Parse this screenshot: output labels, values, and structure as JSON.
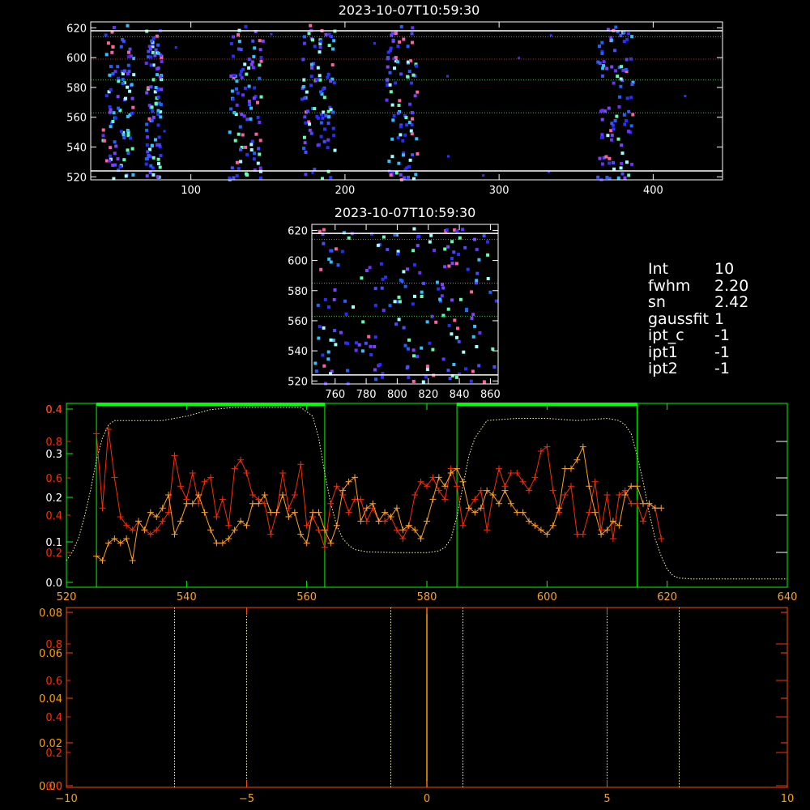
{
  "info_panel": [
    {
      "key": "Int",
      "value": "10"
    },
    {
      "key": "fwhm",
      "value": "2.20"
    },
    {
      "key": "sn",
      "value": "2.42"
    },
    {
      "key": "gaussfit",
      "value": "1"
    },
    {
      "key": "ipt_c",
      "value": "-1"
    },
    {
      "key": "ipt1",
      "value": "-1"
    },
    {
      "key": "ipt2",
      "value": "-1"
    }
  ],
  "colors": {
    "axes": "#ffffff",
    "profile_axes": "#00ff00",
    "red_series": "#ff2a00",
    "orange_series": "#ffa024",
    "dotted_line": "#ffff9a",
    "hline_green": "#22cc22",
    "hline_red": "#cc2020",
    "window_bar": "#00ff00",
    "bottom_axes": "#ff4a00",
    "center_line": "#ffa000"
  },
  "chart_data": [
    {
      "type": "heatmap",
      "title": "2023-10-07T10:59:30",
      "xlim": [
        35,
        445
      ],
      "ylim": [
        518,
        624
      ],
      "xticks": [
        100,
        200,
        300,
        400
      ],
      "yticks": [
        520,
        540,
        560,
        580,
        600,
        620
      ],
      "hlines_white": [
        524,
        618
      ],
      "hlines_green": [
        585,
        563,
        614
      ],
      "hlines_red": [
        599
      ],
      "columns": [
        [
          42,
          62
        ],
        [
          70,
          80
        ],
        [
          124,
          146
        ],
        [
          171,
          193
        ],
        [
          226,
          246
        ],
        [
          363,
          386
        ]
      ]
    },
    {
      "type": "heatmap",
      "title": "2023-10-07T10:59:30",
      "xlim": [
        745,
        865
      ],
      "ylim": [
        518,
        624
      ],
      "xticks": [
        760,
        780,
        800,
        820,
        840,
        860
      ],
      "yticks": [
        520,
        540,
        560,
        580,
        600,
        620
      ],
      "hlines_white": [
        524,
        618
      ],
      "hlines_green": [
        585,
        563,
        614
      ]
    },
    {
      "type": "line",
      "xlim": [
        520,
        640
      ],
      "xticks": [
        520,
        540,
        560,
        580,
        600,
        620,
        640
      ],
      "left_axis_labels_white": [
        "0.0",
        "0.1",
        "0.2",
        "0.3",
        "0.4"
      ],
      "left_axis_labels_red": [
        "0.2",
        "0.4",
        "0.6",
        "0.8"
      ],
      "window_lines": [
        525,
        563,
        585,
        615
      ],
      "window_bars": [
        [
          525,
          563
        ],
        [
          585,
          615
        ]
      ],
      "dotted_profile": {
        "x": [
          520,
          521,
          522,
          523,
          524,
          525,
          526,
          527,
          528,
          530,
          533,
          536,
          540,
          544,
          548,
          552,
          556,
          559,
          561,
          562,
          563,
          564,
          565,
          566,
          567,
          568,
          570,
          575,
          580,
          582,
          583,
          584,
          585,
          586,
          587,
          588,
          590,
          595,
          600,
          605,
          610,
          612,
          613,
          614,
          615,
          616,
          617,
          618,
          619,
          620,
          621,
          622,
          624,
          630,
          640
        ],
        "y": [
          0.05,
          0.07,
          0.1,
          0.15,
          0.21,
          0.28,
          0.33,
          0.36,
          0.37,
          0.37,
          0.37,
          0.37,
          0.38,
          0.395,
          0.4,
          0.4,
          0.4,
          0.4,
          0.38,
          0.33,
          0.25,
          0.18,
          0.13,
          0.1,
          0.085,
          0.075,
          0.07,
          0.068,
          0.068,
          0.072,
          0.08,
          0.1,
          0.15,
          0.22,
          0.29,
          0.33,
          0.37,
          0.375,
          0.375,
          0.37,
          0.375,
          0.37,
          0.36,
          0.34,
          0.29,
          0.23,
          0.16,
          0.1,
          0.06,
          0.03,
          0.015,
          0.01,
          0.008,
          0.008,
          0.008
        ]
      },
      "series": [
        {
          "x": [
            525,
            526,
            527,
            528,
            529,
            530,
            531,
            532,
            533,
            534,
            535,
            536,
            537,
            538,
            539,
            540,
            541,
            542,
            543,
            544,
            545,
            546,
            547,
            548,
            549,
            550,
            551,
            552,
            553,
            554,
            555,
            556,
            557,
            558,
            559,
            560,
            561,
            562,
            563,
            564,
            565,
            566,
            567,
            568,
            569,
            570,
            571,
            572,
            573,
            574,
            575,
            576,
            577,
            578,
            579,
            580,
            581,
            582,
            583,
            584,
            585,
            586,
            587,
            588,
            589,
            590,
            591,
            592,
            593,
            594,
            595,
            596,
            597,
            598,
            599,
            600,
            601,
            602,
            603,
            604,
            605,
            606,
            607,
            608,
            609,
            610,
            611,
            612,
            613,
            614,
            615,
            616,
            617,
            618,
            619
          ],
          "y": [
            0.34,
            0.17,
            0.35,
            0.24,
            0.15,
            0.13,
            0.12,
            0.14,
            0.12,
            0.11,
            0.12,
            0.14,
            0.16,
            0.29,
            0.22,
            0.19,
            0.25,
            0.18,
            0.23,
            0.24,
            0.15,
            0.19,
            0.13,
            0.26,
            0.28,
            0.25,
            0.2,
            0.19,
            0.18,
            0.11,
            0.16,
            0.25,
            0.17,
            0.2,
            0.27,
            0.13,
            0.15,
            0.12,
            0.08,
            0.18,
            0.22,
            0.2,
            0.16,
            0.19,
            0.19,
            0.14,
            0.17,
            0.14,
            0.14,
            0.15,
            0.12,
            0.1,
            0.13,
            0.2,
            0.23,
            0.22,
            0.24,
            0.21,
            0.19,
            0.26,
            0.22,
            0.13,
            0.17,
            0.19,
            0.21,
            0.12,
            0.2,
            0.26,
            0.22,
            0.25,
            0.25,
            0.23,
            0.21,
            0.24,
            0.3,
            0.31,
            0.21,
            0.16,
            0.2,
            0.22,
            0.11,
            0.11,
            0.16,
            0.23,
            0.12,
            0.2,
            0.1,
            0.2,
            0.21,
            0.18,
            0.18,
            0.14,
            0.18,
            0.17,
            0.1
          ]
        },
        {
          "x": [
            525,
            526,
            527,
            528,
            529,
            530,
            531,
            532,
            533,
            534,
            535,
            536,
            537,
            538,
            539,
            540,
            541,
            542,
            543,
            544,
            545,
            546,
            547,
            548,
            549,
            550,
            551,
            552,
            553,
            554,
            555,
            556,
            557,
            558,
            559,
            560,
            561,
            562,
            563,
            564,
            565,
            566,
            567,
            568,
            569,
            570,
            571,
            572,
            573,
            574,
            575,
            576,
            577,
            578,
            579,
            580,
            581,
            582,
            583,
            584,
            585,
            586,
            587,
            588,
            589,
            590,
            591,
            592,
            593,
            594,
            595,
            596,
            597,
            598,
            599,
            600,
            601,
            602,
            603,
            604,
            605,
            606,
            607,
            608,
            609,
            610,
            611,
            612,
            613,
            614,
            615,
            616,
            617,
            618,
            619
          ],
          "y": [
            0.06,
            0.05,
            0.09,
            0.1,
            0.09,
            0.1,
            0.05,
            0.14,
            0.12,
            0.16,
            0.15,
            0.17,
            0.2,
            0.11,
            0.14,
            0.18,
            0.18,
            0.2,
            0.16,
            0.12,
            0.09,
            0.09,
            0.1,
            0.12,
            0.14,
            0.13,
            0.18,
            0.18,
            0.2,
            0.16,
            0.16,
            0.2,
            0.15,
            0.16,
            0.11,
            0.09,
            0.16,
            0.16,
            0.12,
            0.09,
            0.13,
            0.21,
            0.23,
            0.24,
            0.14,
            0.17,
            0.18,
            0.14,
            0.16,
            0.15,
            0.17,
            0.12,
            0.13,
            0.12,
            0.1,
            0.14,
            0.19,
            0.24,
            0.22,
            0.25,
            0.26,
            0.23,
            0.17,
            0.16,
            0.17,
            0.21,
            0.2,
            0.18,
            0.21,
            0.18,
            0.16,
            0.16,
            0.14,
            0.13,
            0.12,
            0.11,
            0.13,
            0.17,
            0.26,
            0.26,
            0.28,
            0.31,
            0.22,
            0.16,
            0.11,
            0.12,
            0.14,
            0.13,
            0.2,
            0.22,
            0.22,
            0.18,
            0.18,
            0.17,
            0.17
          ]
        }
      ]
    },
    {
      "type": "line",
      "xlim": [
        -10,
        10
      ],
      "xticks": [
        -10,
        -5,
        0,
        5,
        10
      ],
      "left_axis_labels_orange": [
        "0.00",
        "0.02",
        "0.04",
        "0.06",
        "0.08"
      ],
      "left_axis_labels_red": [
        "0.0",
        "0.2",
        "0.4",
        "0.6",
        "0.8"
      ],
      "vlines_dotted": [
        -7,
        -5,
        -1,
        1,
        5,
        7
      ],
      "vline_center": 0
    }
  ]
}
